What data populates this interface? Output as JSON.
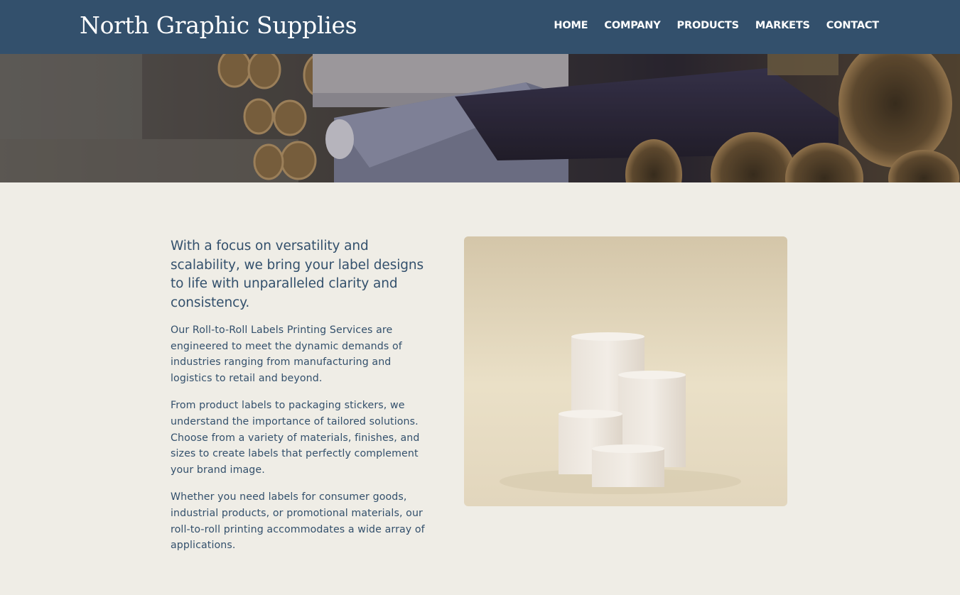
{
  "header": {
    "brand": "North Graphic Supplies",
    "nav": [
      "HOME",
      "COMPANY",
      "PRODUCTS",
      "MARKETS",
      "CONTACT"
    ]
  },
  "content": {
    "lead": "With a focus on versatility and scalability, we bring your label designs to life with unparalleled clarity and consistency.",
    "paragraphs": [
      "Our Roll-to-Roll Labels Printing Services are engineered to meet the dynamic demands of industries ranging from manufacturing and logistics to retail and beyond.",
      "From product labels to packaging stickers, we understand the importance of tailored solutions. Choose from a variety of materials, finishes, and sizes to create labels that perfectly complement your brand image.",
      "Whether you need labels for consumer goods, industrial products, or promotional materials, our roll-to-roll printing accommodates a wide array of applications."
    ]
  },
  "colors": {
    "header_bg": "#33506c",
    "page_bg": "#efede6",
    "text": "#33506c"
  }
}
